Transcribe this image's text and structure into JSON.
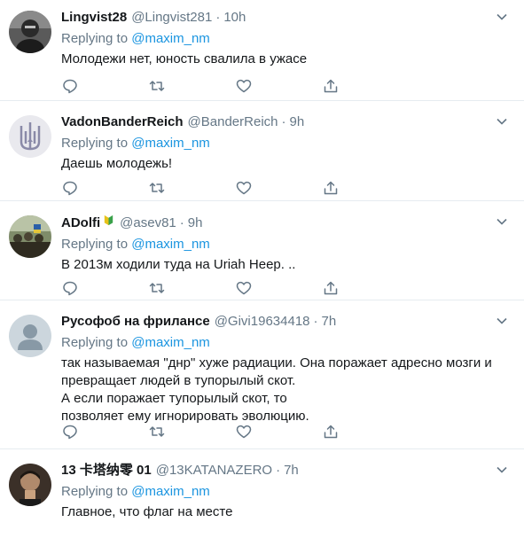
{
  "tweets": [
    {
      "name": "Lingvist28",
      "handle": "@Lingvist281",
      "time": "10h",
      "reply_prefix": "Replying to",
      "reply_to": "@maxim_nm",
      "lines": [
        "Молодежи нет, юность свалила в ужасе"
      ],
      "avatar_icon": "avatar-photo-person"
    },
    {
      "name": "VadonBanderReich",
      "handle": "@BanderReich",
      "time": "9h",
      "reply_prefix": "Replying to",
      "reply_to": "@maxim_nm",
      "lines": [
        "Даешь молодежь!"
      ],
      "avatar_icon": "trident-emblem"
    },
    {
      "name": "ADolfi",
      "handle": "@asev81",
      "time": "9h",
      "reply_prefix": "Replying to",
      "reply_to": "@maxim_nm",
      "lines": [
        "В 2013м ходили туда на Uriah Heep. .."
      ],
      "avatar_icon": "avatar-photo-crowd",
      "badge_icon": "beginner-mark-icon"
    },
    {
      "name": "Русофоб на фрилансе",
      "handle": "@Givi19634418",
      "time": "7h",
      "reply_prefix": "Replying to",
      "reply_to": "@maxim_nm",
      "lines": [
        "так называемая \"днр\" хуже радиации. Она поражает адресно мозги и",
        "превращает людей в тупорылый скот.",
        "А если поражает тупорылый скот, то",
        "позволяет ему игнорировать эволюцию."
      ],
      "avatar_icon": "default-avatar"
    },
    {
      "name": "13 卡塔纳零 01",
      "handle": "@13KATANAZERO",
      "time": "7h",
      "reply_prefix": "Replying to",
      "reply_to": "@maxim_nm",
      "lines": [
        "Главное, что флаг на месте"
      ],
      "avatar_icon": "avatar-photo-person"
    }
  ],
  "separator": "·",
  "colors": {
    "link": "#1b95e0",
    "secondary": "#657786",
    "text": "#14171a",
    "divider": "#e6ecf0"
  }
}
